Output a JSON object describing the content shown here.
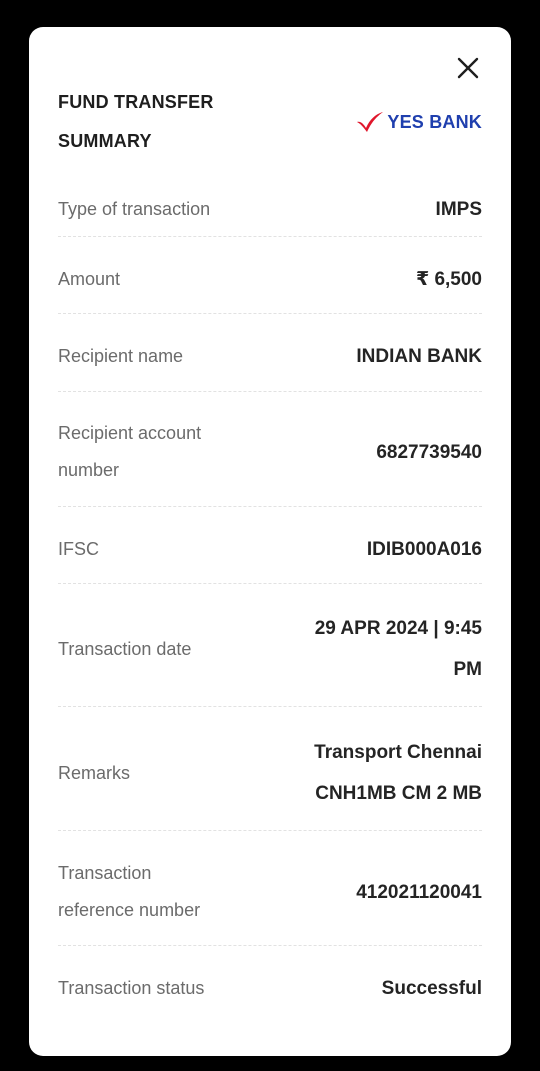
{
  "dialog": {
    "title": "FUND TRANSFER SUMMARY",
    "close_icon": "close-icon",
    "bank_logo": {
      "icon": "yes-bank-checkmark-icon",
      "text": "YES BANK",
      "check_color": "#e0162b",
      "text_color": "#1f3fae"
    }
  },
  "details": [
    {
      "label": "Type of transaction",
      "value": "IMPS"
    },
    {
      "label": "Amount",
      "value": "₹ 6,500"
    },
    {
      "label": "Recipient name",
      "value": "INDIAN BANK"
    },
    {
      "label": "Recipient account number",
      "value": "6827739540"
    },
    {
      "label": "IFSC",
      "value": "IDIB000A016"
    },
    {
      "label": "Transaction date",
      "value": "29 APR 2024 | 9:45 PM"
    },
    {
      "label": "Remarks",
      "value": "Transport Chennai CNH1MB CM 2 MB"
    },
    {
      "label": "Transaction reference number",
      "value": "412021120041"
    },
    {
      "label": "Transaction status",
      "value": "Successful"
    }
  ]
}
